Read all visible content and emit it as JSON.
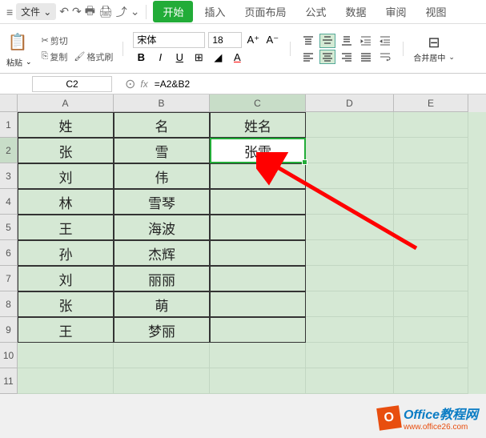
{
  "menubar": {
    "menu_icon": "≡",
    "file_label": "文件",
    "file_dropdown": "⌄",
    "quick": [
      "↶",
      "↷",
      "🖶",
      "🖨",
      "⤴",
      "⌄"
    ],
    "tabs": {
      "start": "开始",
      "insert": "插入",
      "layout": "页面布局",
      "formula": "公式",
      "data": "数据",
      "review": "审阅",
      "view": "视图"
    }
  },
  "ribbon": {
    "paste_label": "粘贴",
    "paste_dropdown": "⌄",
    "cut_label": "剪切",
    "copy_label": "复制",
    "format_painter_label": "格式刷",
    "font_name": "宋体",
    "font_size": "18",
    "bold": "B",
    "italic": "I",
    "underline": "U",
    "merge_label": "合并居中",
    "merge_dropdown": "⌄"
  },
  "formula_bar": {
    "cell_ref": "C2",
    "fx_label": "fx",
    "formula": "=A2&B2"
  },
  "columns": [
    "A",
    "B",
    "C",
    "D",
    "E"
  ],
  "rows": [
    "1",
    "2",
    "3",
    "4",
    "5",
    "6",
    "7",
    "8",
    "9",
    "10",
    "11"
  ],
  "cells": {
    "A1": "姓",
    "B1": "名",
    "C1": "姓名",
    "A2": "张",
    "B2": "雪",
    "C2": "张雪",
    "A3": "刘",
    "B3": "伟",
    "A4": "林",
    "B4": "雪琴",
    "A5": "王",
    "B5": "海波",
    "A6": "孙",
    "B6": "杰辉",
    "A7": "刘",
    "B7": "丽丽",
    "A8": "张",
    "B8": "萌",
    "A9": "王",
    "B9": "梦丽"
  },
  "watermark": {
    "logo_letter": "O",
    "title": "Office教程网",
    "url": "www.office26.com"
  }
}
